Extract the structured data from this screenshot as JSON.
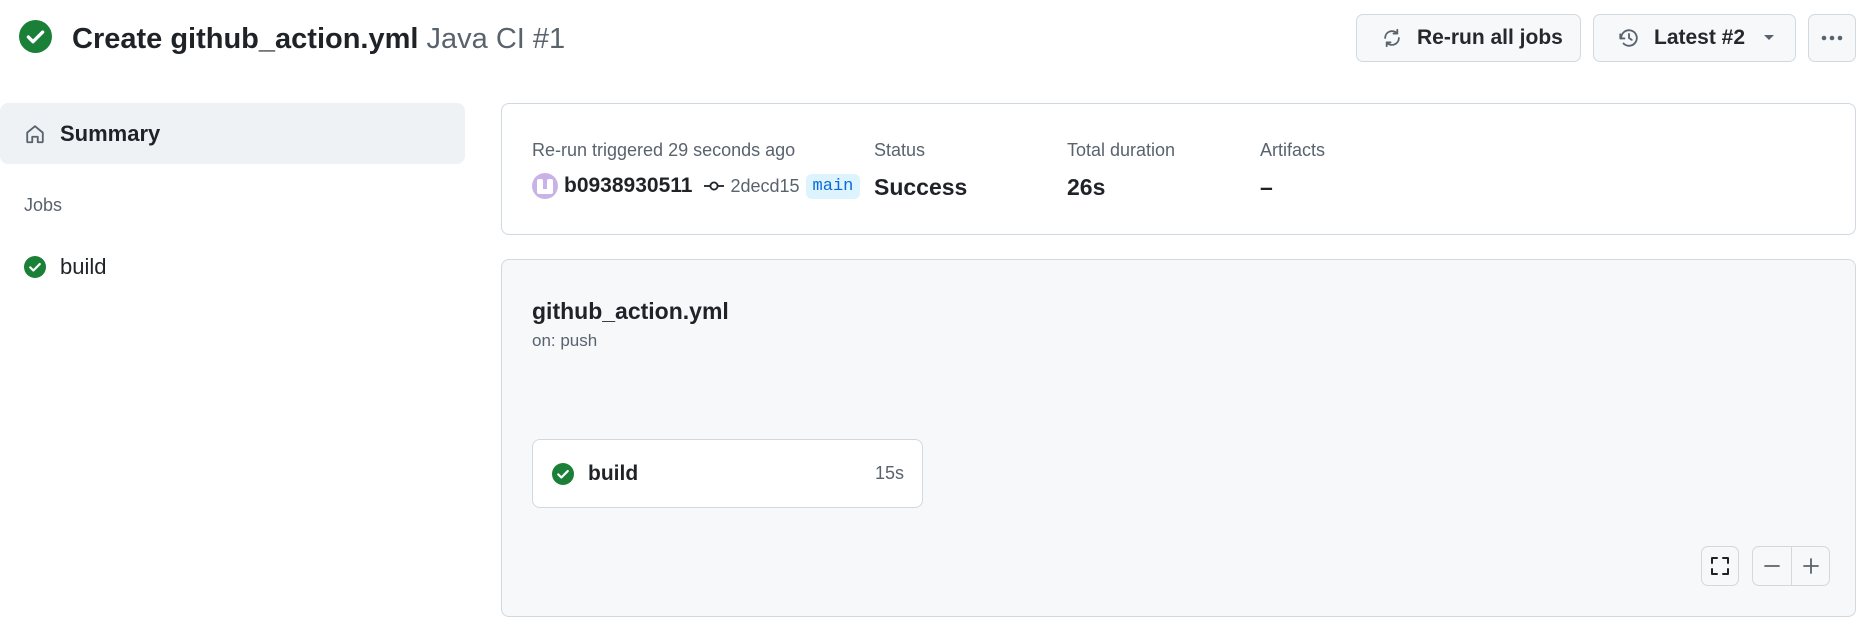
{
  "header": {
    "title": "Create github_action.yml",
    "subtitle": "Java CI #1",
    "status_icon": "check-circle-fill-icon",
    "status_color": "#1a7f37",
    "rerun_label": "Re-run all jobs",
    "latest_label": "Latest #2"
  },
  "sidebar": {
    "summary_label": "Summary",
    "jobs_heading": "Jobs",
    "jobs": [
      {
        "label": "build",
        "status": "success"
      }
    ]
  },
  "summary": {
    "trigger_text": "Re-run triggered 29 seconds ago",
    "user": "b0938930511",
    "commit_sha": "2decd15",
    "branch": "main",
    "status_label": "Status",
    "status_value": "Success",
    "duration_label": "Total duration",
    "duration_value": "26s",
    "artifacts_label": "Artifacts",
    "artifacts_value": "–"
  },
  "workflow": {
    "name": "github_action.yml",
    "trigger": "on: push",
    "jobs": [
      {
        "label": "build",
        "duration": "15s",
        "status": "success"
      }
    ]
  },
  "colors": {
    "success": "#1a7f37",
    "border": "#d1d9e0",
    "muted_text": "#59636e",
    "branch_bg": "#ddf4ff",
    "branch_text": "#0969da"
  }
}
